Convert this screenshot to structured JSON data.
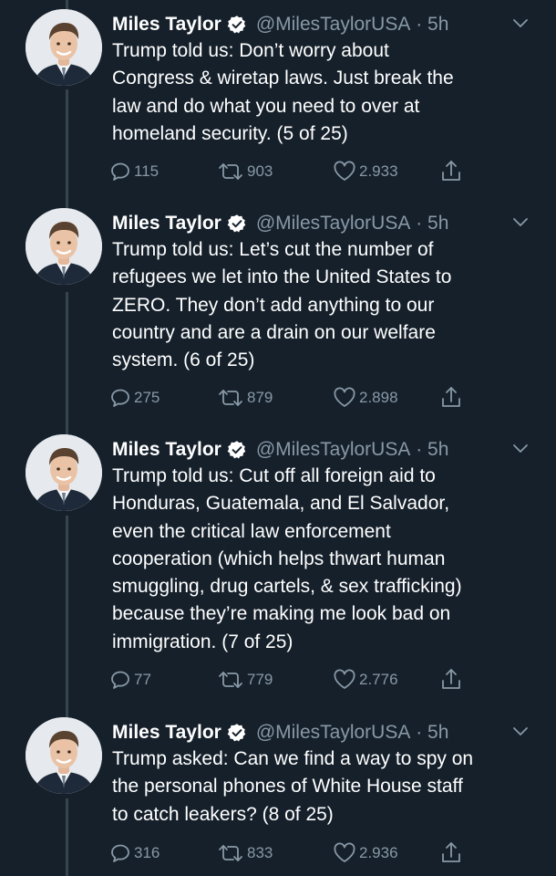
{
  "tweets": [
    {
      "name": "Miles Taylor",
      "handle": "@MilesTaylorUSA",
      "time": "5h",
      "lines": [
        "Trump told us: Don’t worry about",
        "Congress & wiretap laws. Just break the",
        "law and do what you need to over at",
        "homeland security. (5 of 25)"
      ],
      "replies": "115",
      "retweets": "903",
      "likes": "2.933"
    },
    {
      "name": "Miles Taylor",
      "handle": "@MilesTaylorUSA",
      "time": "5h",
      "lines": [
        "Trump told us: Let’s cut the number of",
        "refugees we let into the United States to",
        "ZERO. They don’t add anything to our",
        "country and are a drain on our welfare",
        "system. (6 of 25)"
      ],
      "replies": "275",
      "retweets": "879",
      "likes": "2.898"
    },
    {
      "name": "Miles Taylor",
      "handle": "@MilesTaylorUSA",
      "time": "5h",
      "lines": [
        "Trump told us: Cut off all foreign aid to",
        "Honduras, Guatemala, and El Salvador,",
        "even the critical law enforcement",
        "cooperation (which helps thwart human",
        "smuggling, drug cartels, & sex trafficking)",
        "because they’re making me look bad on",
        "immigration. (7 of 25)"
      ],
      "replies": "77",
      "retweets": "779",
      "likes": "2.776"
    },
    {
      "name": "Miles Taylor",
      "handle": "@MilesTaylorUSA",
      "time": "5h",
      "lines": [
        "Trump asked: Can we find a way to spy on",
        "the personal phones of White House staff",
        "to catch leakers? (8 of 25)"
      ],
      "replies": "316",
      "retweets": "833",
      "likes": "2.936"
    }
  ],
  "colors": {
    "background": "#15202b",
    "text": "#ffffff",
    "secondary": "#8899a6",
    "verified": "#ffffff",
    "thread_line": "#38444d"
  },
  "icons": {
    "verified": "verified-badge-icon",
    "reply": "reply-icon",
    "retweet": "retweet-icon",
    "like": "heart-icon",
    "share": "share-icon",
    "menu": "chevron-down-icon"
  }
}
